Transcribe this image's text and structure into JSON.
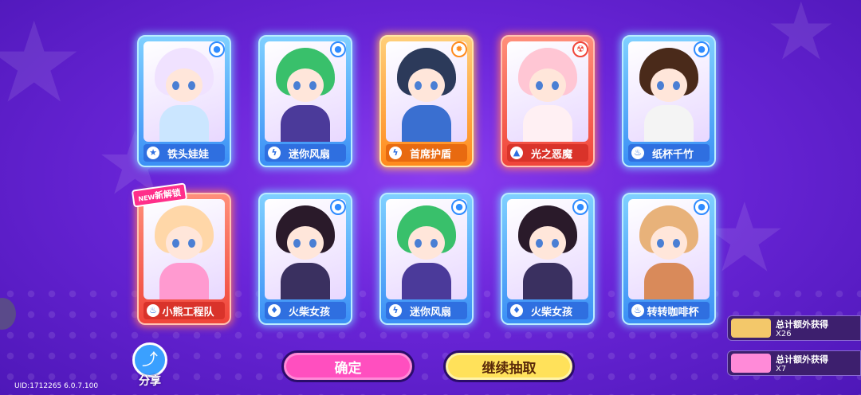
{
  "cards": [
    {
      "name": "铁头娃娃",
      "rarity": "blue",
      "type_icon": "star-icon",
      "badge_icon": "bomb-icon",
      "hair": "#f0e2ff",
      "body": "#cbe6ff"
    },
    {
      "name": "迷你风扇",
      "rarity": "blue",
      "type_icon": "lightning-icon",
      "badge_icon": "bomb-icon",
      "hair": "#39c06b",
      "body": "#4b3a9a"
    },
    {
      "name": "首席护盾",
      "rarity": "orange",
      "type_icon": "lightning-icon",
      "badge_icon": "gear-icon",
      "hair": "#2c3a5a",
      "body": "#3a6fd0"
    },
    {
      "name": "光之恶魔",
      "rarity": "red",
      "type_icon": "triangle-icon",
      "badge_icon": "radiation-icon",
      "hair": "#ffc6d4",
      "body": "#fff0f3"
    },
    {
      "name": "纸杯千竹",
      "rarity": "blue",
      "type_icon": "cupcake-icon",
      "badge_icon": "bomb-icon",
      "hair": "#4a2a1a",
      "body": "#f4f4f4"
    },
    {
      "name": "小熊工程队",
      "rarity": "red",
      "type_icon": "cupcake-icon",
      "badge_icon": "",
      "hair": "#ffd7a8",
      "body": "#ff9ad0",
      "tag": "新解锁",
      "tag_prefix": "NEW"
    },
    {
      "name": "火柴女孩",
      "rarity": "blue",
      "type_icon": "flame-icon",
      "badge_icon": "bomb-icon",
      "hair": "#2a1a2a",
      "body": "#3a3060"
    },
    {
      "name": "迷你风扇",
      "rarity": "blue",
      "type_icon": "lightning-icon",
      "badge_icon": "bomb-icon",
      "hair": "#39c06b",
      "body": "#4b3a9a"
    },
    {
      "name": "火柴女孩",
      "rarity": "blue",
      "type_icon": "flame-icon",
      "badge_icon": "bomb-icon",
      "hair": "#2a1a2a",
      "body": "#3a3060"
    },
    {
      "name": "转转咖啡杯",
      "rarity": "blue",
      "type_icon": "cupcake-icon",
      "badge_icon": "bomb-icon",
      "hair": "#e8b27a",
      "body": "#d98a5a"
    }
  ],
  "share": {
    "label": "分享",
    "icon": "share-icon"
  },
  "buttons": {
    "confirm": "确定",
    "continue": "继续抽取"
  },
  "uid": "UID:1712265 6.0.7.100",
  "extras": [
    {
      "label": "总计额外获得",
      "count": "X26",
      "color": "#f3c86a"
    },
    {
      "label": "总计额外获得",
      "count": "X7",
      "color": "#ff8ad8"
    }
  ],
  "type_glyphs": {
    "star-icon": "★",
    "lightning-icon": "ϟ",
    "triangle-icon": "▲",
    "cupcake-icon": "♨",
    "flame-icon": "♦"
  },
  "badge_glyphs": {
    "bomb-icon": "●",
    "gear-icon": "✹",
    "radiation-icon": "☢"
  }
}
